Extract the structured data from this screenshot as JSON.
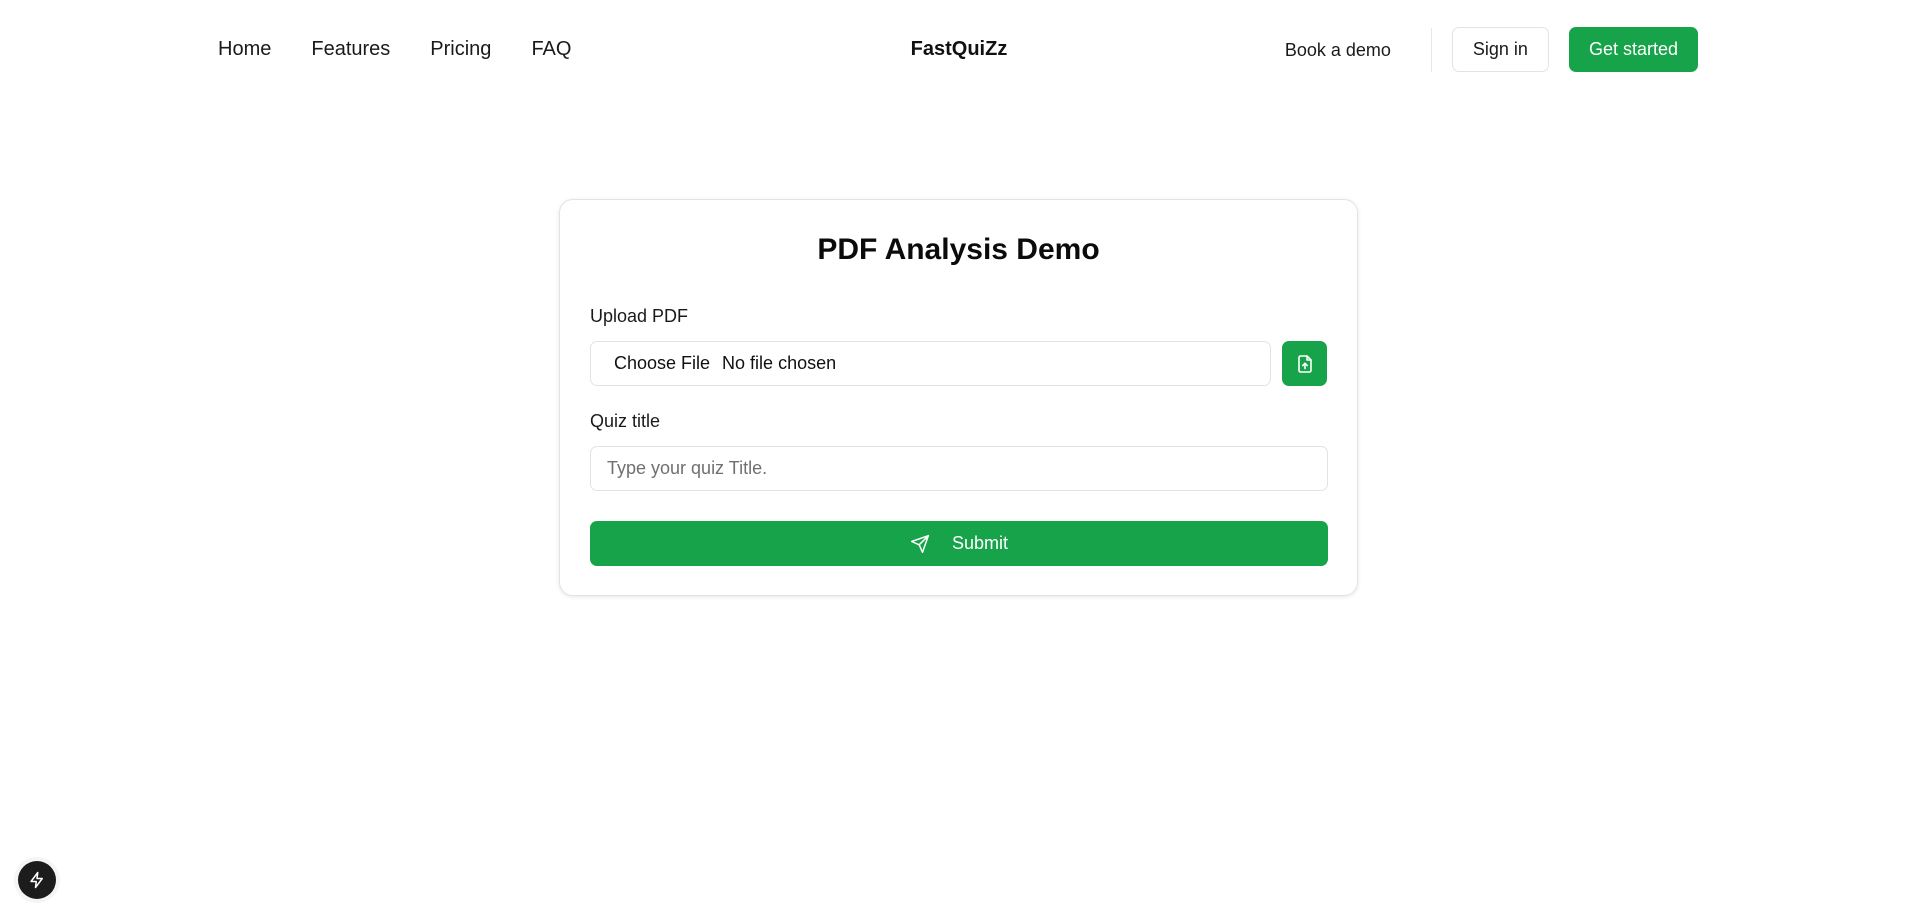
{
  "header": {
    "nav": [
      {
        "label": "Home"
      },
      {
        "label": "Features"
      },
      {
        "label": "Pricing"
      },
      {
        "label": "FAQ"
      }
    ],
    "brand": "FastQuiZz",
    "book_demo_label": "Book a demo",
    "sign_in_label": "Sign in",
    "get_started_label": "Get started"
  },
  "form": {
    "title": "PDF Analysis Demo",
    "upload_label": "Upload PDF",
    "file_button_label": "Choose File",
    "file_status": "No file chosen",
    "quiz_title_label": "Quiz title",
    "quiz_title_placeholder": "Type your quiz Title.",
    "quiz_title_value": "",
    "submit_label": "Submit"
  },
  "icons": {
    "upload": "file-upload-icon",
    "submit": "send-icon",
    "badge": "lightning-icon"
  },
  "colors": {
    "accent": "#17a34a",
    "badge_bg": "#1c1c1c"
  }
}
